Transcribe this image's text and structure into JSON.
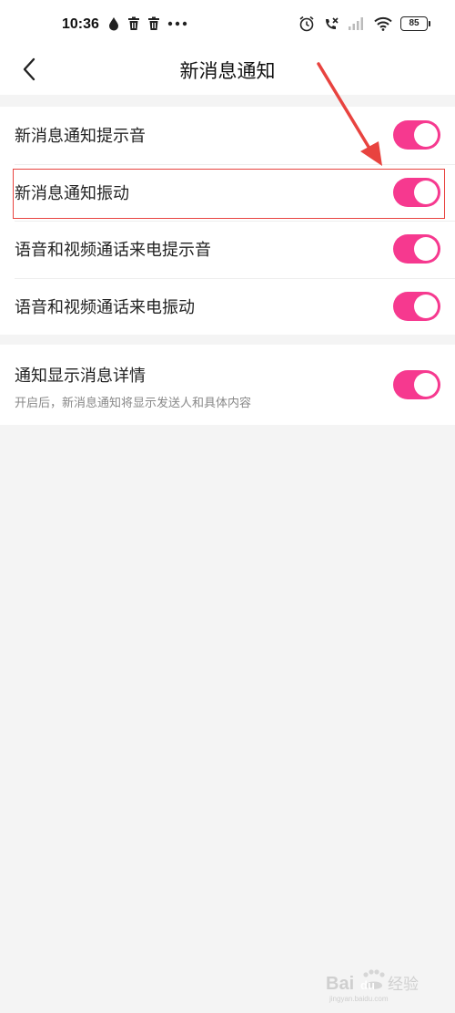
{
  "status_bar": {
    "time": "10:36",
    "battery": "85",
    "left_icons": [
      "water-drop-icon",
      "trash-icon",
      "trash-icon",
      "more-dots-icon"
    ],
    "right_icons": [
      "alarm-icon",
      "missed-call-icon",
      "signal-off-icon",
      "wifi-icon"
    ]
  },
  "header": {
    "title": "新消息通知",
    "back_icon": "chevron-left-icon"
  },
  "settings": {
    "group1": [
      {
        "label": "新消息通知提示音",
        "enabled": true
      },
      {
        "label": "新消息通知振动",
        "enabled": true
      },
      {
        "label": "语音和视频通话来电提示音",
        "enabled": true
      },
      {
        "label": "语音和视频通话来电振动",
        "enabled": true
      }
    ],
    "group2": [
      {
        "label": "通知显示消息详情",
        "sublabel": "开启后，新消息通知将显示发送人和具体内容",
        "enabled": true
      }
    ]
  },
  "theme": {
    "accent": "#f6398f",
    "annotation": "#e8433f"
  },
  "watermark": {
    "text": "Bai du 经验",
    "url": "jingyan.baidu.com"
  }
}
